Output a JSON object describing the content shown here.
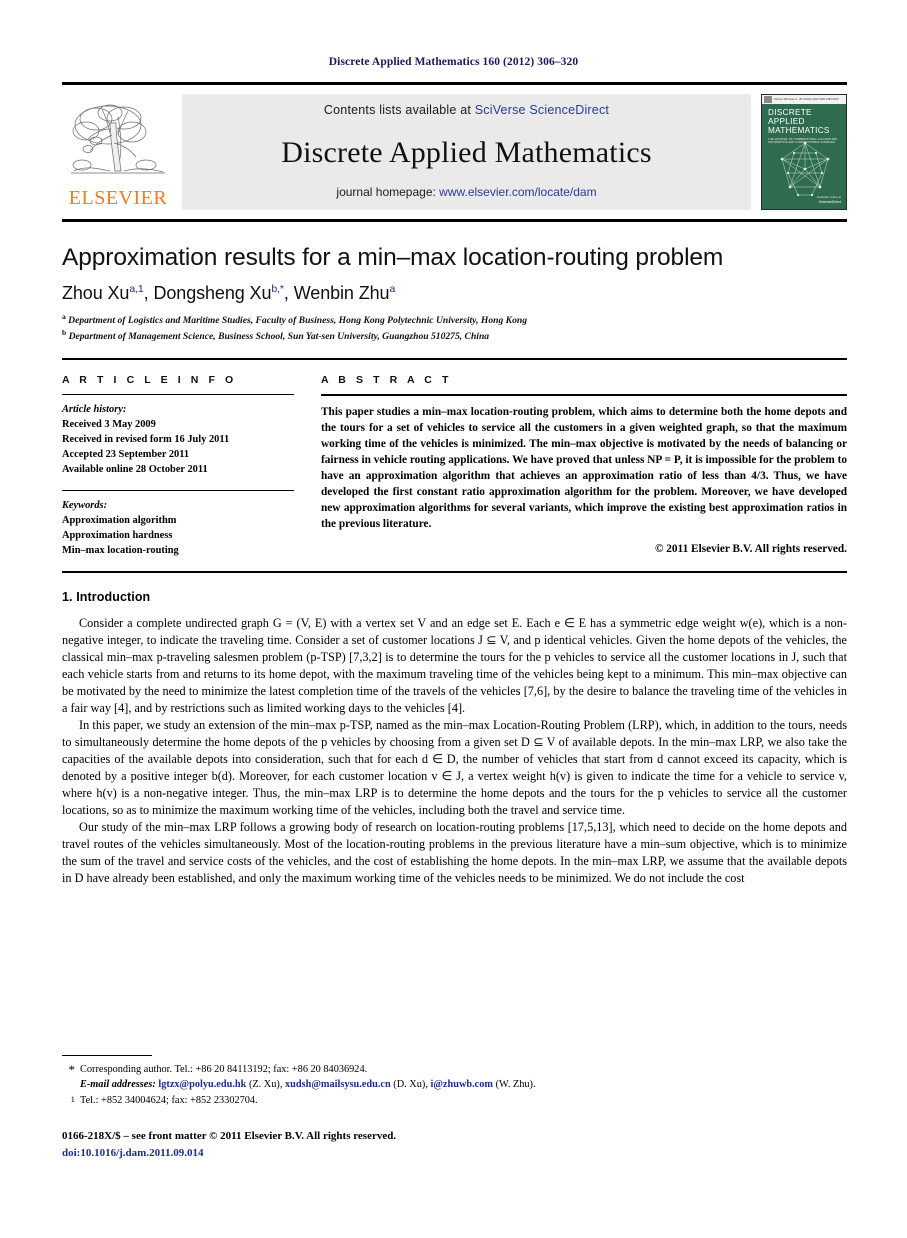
{
  "running_head": "Discrete Applied Mathematics 160 (2012) 306–320",
  "masthead": {
    "contents_prefix": "Contents lists available at ",
    "sciencedirect_link": "SciVerse ScienceDirect",
    "journal_title": "Discrete Applied Mathematics",
    "homepage_prefix": "journal homepage: ",
    "homepage_url": "www.elsevier.com/locate/dam",
    "publisher_wordmark": "ELSEVIER",
    "publisher_color": "#f07c22",
    "cover": {
      "topbar_text": "Volume 160 Issue 3  ·  28 October 2012      ISSN 0166-218X",
      "title_lines": [
        "DISCRETE",
        "APPLIED",
        "MATHEMATICS"
      ],
      "subtitle": "THE JOURNAL OF COMBINATORIAL ALGORITHMS, INFORMATICS AND COMPUTATIONAL SCIENCES",
      "footer_line1": "Available online at",
      "footer_line2": "ScienceDirect",
      "background_color": "#2e6b4f"
    }
  },
  "article": {
    "title": "Approximation results for a min–max location-routing problem",
    "authors": [
      {
        "name": "Zhou Xu",
        "marks": "a,1"
      },
      {
        "name": "Dongsheng Xu",
        "marks": "b,*"
      },
      {
        "name": "Wenbin Zhu",
        "marks": "a"
      }
    ],
    "affiliations": [
      {
        "mark": "a",
        "text": "Department of Logistics and Maritime Studies, Faculty of Business, Hong Kong Polytechnic University, Hong Kong"
      },
      {
        "mark": "b",
        "text": "Department of Management Science, Business School, Sun Yat-sen University, Guangzhou 510275, China"
      }
    ]
  },
  "article_info": {
    "heading": "A R T I C L E   I N F O",
    "history_label": "Article history:",
    "history": [
      "Received 3 May 2009",
      "Received in revised form 16 July 2011",
      "Accepted 23 September 2011",
      "Available online 28 October 2011"
    ],
    "keywords_label": "Keywords:",
    "keywords": [
      "Approximation algorithm",
      "Approximation hardness",
      "Min–max location-routing"
    ]
  },
  "abstract": {
    "heading": "A B S T R A C T",
    "text": "This paper studies a min–max location-routing problem, which aims to determine both the home depots and the tours for a set of vehicles to service all the customers in a given weighted graph, so that the maximum working time of the vehicles is minimized. The min–max objective is motivated by the needs of balancing or fairness in vehicle routing applications. We have proved that unless NP = P, it is impossible for the problem to have an approximation algorithm that achieves an approximation ratio of less than 4/3. Thus, we have developed the first constant ratio approximation algorithm for the problem. Moreover, we have developed new approximation algorithms for several variants, which improve the existing best approximation ratios in the previous literature.",
    "copyright": "© 2011 Elsevier B.V. All rights reserved."
  },
  "sections": {
    "intro_heading": "1. Introduction",
    "paragraphs": [
      "Consider a complete undirected graph G = (V, E) with a vertex set V and an edge set E. Each e ∈ E has a symmetric edge weight w(e), which is a non-negative integer, to indicate the traveling time. Consider a set of customer locations J ⊆ V, and p identical vehicles. Given the home depots of the vehicles, the classical min–max p-traveling salesmen problem (p-TSP) [7,3,2] is to determine the tours for the p vehicles to service all the customer locations in J, such that each vehicle starts from and returns to its home depot, with the maximum traveling time of the vehicles being kept to a minimum. This min–max objective can be motivated by the need to minimize the latest completion time of the travels of the vehicles [7,6], by the desire to balance the traveling time of the vehicles in a fair way [4], and by restrictions such as limited working days to the vehicles [4].",
      "In this paper, we study an extension of the min–max p-TSP, named as the min–max Location-Routing Problem (LRP), which, in addition to the tours, needs to simultaneously determine the home depots of the p vehicles by choosing from a given set D ⊆ V of available depots. In the min–max LRP, we also take the capacities of the available depots into consideration, such that for each d ∈ D, the number of vehicles that start from d cannot exceed its capacity, which is denoted by a positive integer b(d). Moreover, for each customer location v ∈ J, a vertex weight h(v) is given to indicate the time for a vehicle to service v, where h(v) is a non-negative integer. Thus, the min–max LRP is to determine the home depots and the tours for the p vehicles to service all the customer locations, so as to minimize the maximum working time of the vehicles, including both the travel and service time.",
      "Our study of the min–max LRP follows a growing body of research on location-routing problems [17,5,13], which need to decide on the home depots and travel routes of the vehicles simultaneously. Most of the location-routing problems in the previous literature have a min–sum objective, which is to minimize the sum of the travel and service costs of the vehicles, and the cost of establishing the home depots. In the min–max LRP, we assume that the available depots in D have already been established, and only the maximum working time of the vehicles needs to be minimized. We do not include the cost"
    ]
  },
  "footnotes": {
    "corresponding": {
      "mark": "*",
      "text": "Corresponding author. Tel.: +86 20 84113192; fax: +86 20 84036924."
    },
    "emails": {
      "label": "E-mail addresses:",
      "entries": [
        {
          "address": "lgtzx@polyu.edu.hk",
          "person": "(Z. Xu)"
        },
        {
          "address": "xudsh@mailsysu.edu.cn",
          "person": "(D. Xu)"
        },
        {
          "address": "i@zhuwb.com",
          "person": "(W. Zhu)"
        }
      ]
    },
    "note1": {
      "mark": "1",
      "text": "Tel.: +852 34004624; fax: +852 23302704."
    }
  },
  "colophon": {
    "issn_line": "0166-218X/$ – see front matter © 2011 Elsevier B.V. All rights reserved.",
    "doi": "doi:10.1016/j.dam.2011.09.014"
  }
}
